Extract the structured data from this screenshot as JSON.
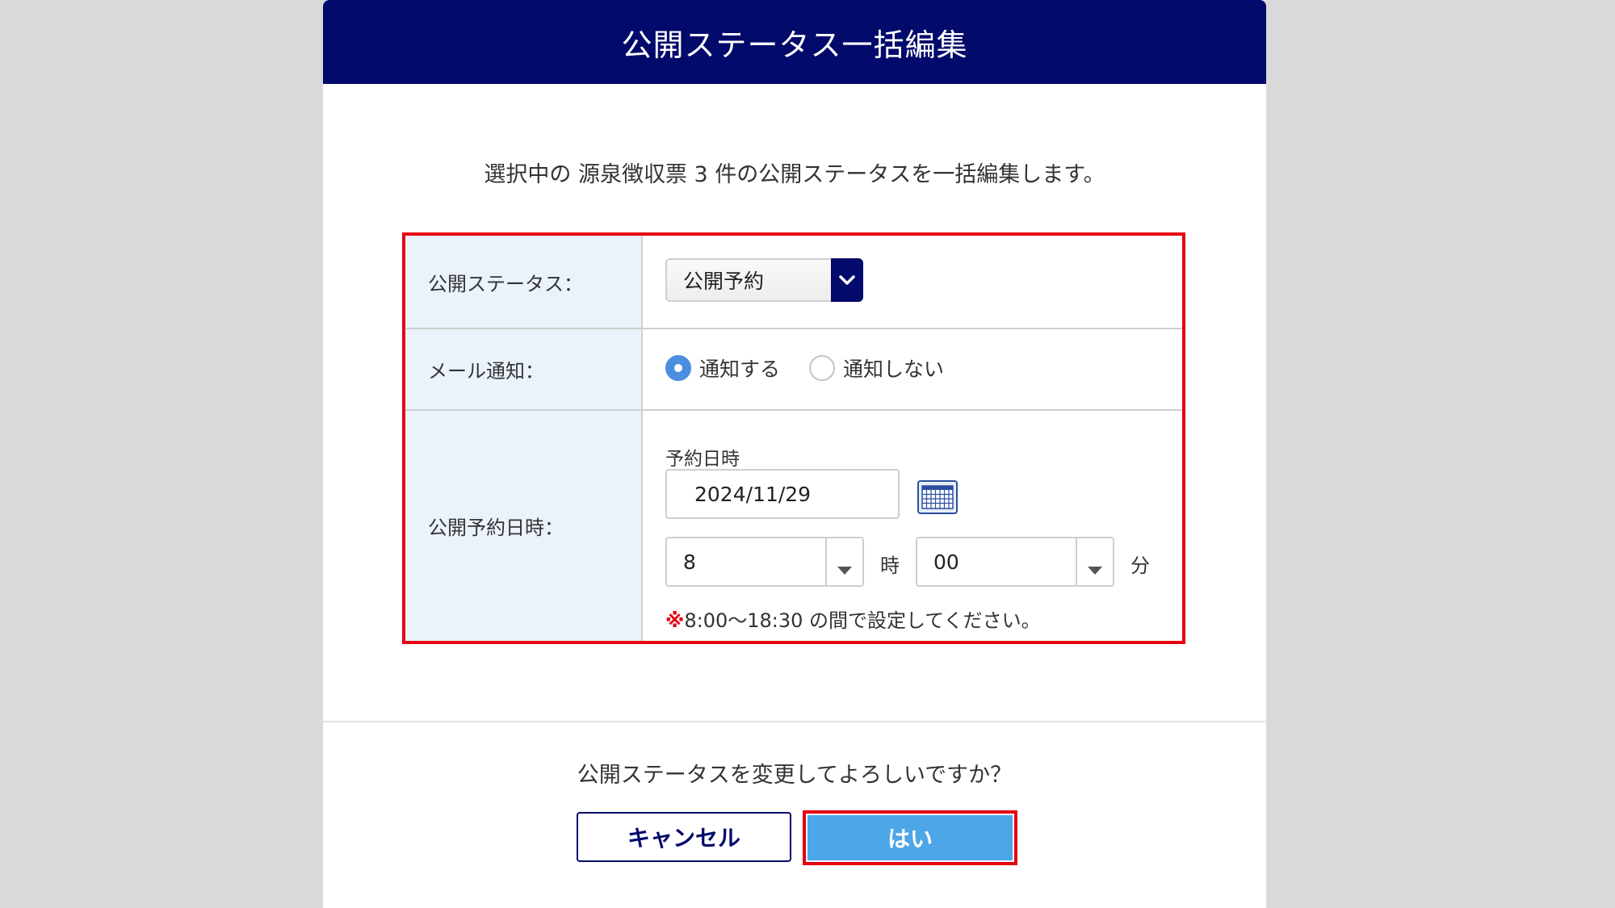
{
  "dialog": {
    "title": "公開ステータス一括編集",
    "description": "選択中の 源泉徴収票 3 件の公開ステータスを一括編集します。"
  },
  "form": {
    "status": {
      "label": "公開ステータス：",
      "selected": "公開予約"
    },
    "mail": {
      "label": "メール通知：",
      "options": [
        "通知する",
        "通知しない"
      ],
      "selected": "通知する"
    },
    "schedule": {
      "label": "公開予約日時：",
      "caption": "予約日時",
      "date": "2024/11/29",
      "hour": "8",
      "hour_unit": "時",
      "minute": "00",
      "minute_unit": "分",
      "note_mark": "※",
      "note": "8:00～18:30 の間で設定してください。"
    }
  },
  "footer": {
    "confirm": "公開ステータスを変更してよろしいですか？",
    "cancel_label": "キャンセル",
    "yes_label": "はい"
  },
  "colors": {
    "header": "#020a6b",
    "highlight": "#e60012",
    "primary_button": "#4da6e8",
    "label_bg": "#eaf2fb"
  }
}
